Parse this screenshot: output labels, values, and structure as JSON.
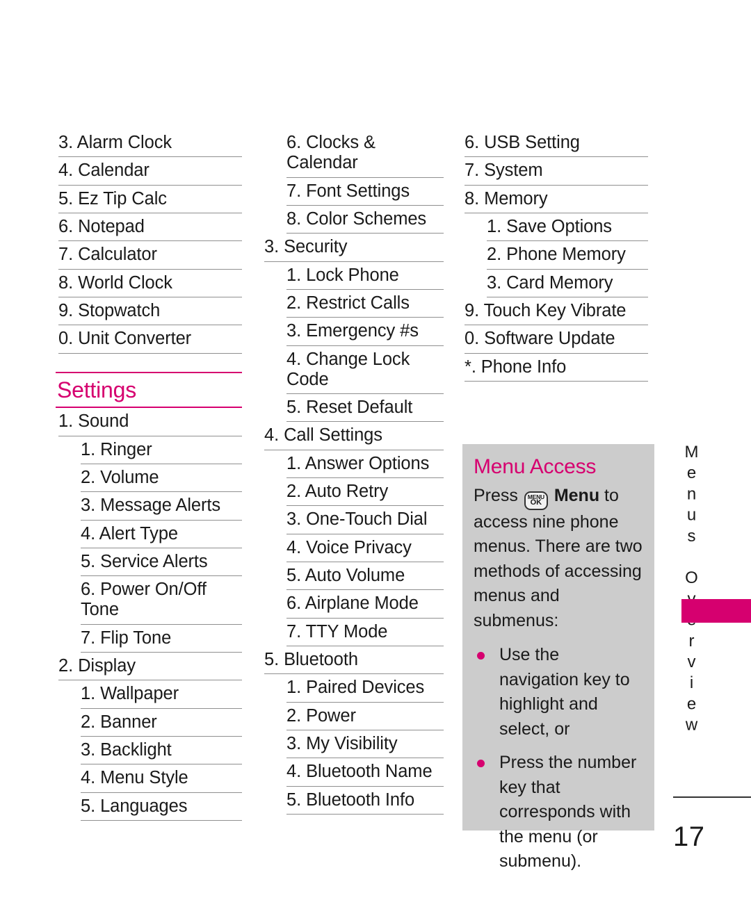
{
  "page": {
    "number": "17",
    "side_tab_label": "Menus Overview",
    "accent_color": "#d6006f",
    "rule_color": "#8f8f8f",
    "callout_bg": "#cccccc"
  },
  "columns": [
    {
      "id": "column-1",
      "items": [
        {
          "level": 2,
          "num": "3.",
          "label": "Alarm Clock"
        },
        {
          "level": 2,
          "num": "4.",
          "label": "Calendar"
        },
        {
          "level": 2,
          "num": "5.",
          "label": "Ez Tip Calc"
        },
        {
          "level": 2,
          "num": "6.",
          "label": "Notepad"
        },
        {
          "level": 2,
          "num": "7.",
          "label": "Calculator"
        },
        {
          "level": 2,
          "num": "8.",
          "label": "World Clock"
        },
        {
          "level": 2,
          "num": "9.",
          "label": "Stopwatch"
        },
        {
          "level": 2,
          "num": "0.",
          "label": "Unit Converter"
        }
      ],
      "section": {
        "title": "Settings",
        "items": [
          {
            "level": 2,
            "num": "1.",
            "label": "Sound"
          },
          {
            "level": 3,
            "num": "1.",
            "label": "Ringer"
          },
          {
            "level": 3,
            "num": "2.",
            "label": "Volume"
          },
          {
            "level": 3,
            "num": "3.",
            "label": "Message Alerts"
          },
          {
            "level": 3,
            "num": "4.",
            "label": "Alert Type"
          },
          {
            "level": 3,
            "num": "5.",
            "label": "Service Alerts"
          },
          {
            "level": 3,
            "num": "6.",
            "label": "Power On/Off Tone"
          },
          {
            "level": 3,
            "num": "7.",
            "label": "Flip Tone"
          },
          {
            "level": 2,
            "num": "2.",
            "label": "Display"
          },
          {
            "level": 3,
            "num": "1.",
            "label": "Wallpaper"
          },
          {
            "level": 3,
            "num": "2.",
            "label": "Banner"
          },
          {
            "level": 3,
            "num": "3.",
            "label": "Backlight"
          },
          {
            "level": 3,
            "num": "4.",
            "label": "Menu Style"
          },
          {
            "level": 3,
            "num": "5.",
            "label": "Languages"
          }
        ]
      }
    },
    {
      "id": "column-2",
      "items": [
        {
          "level": 3,
          "num": "6.",
          "label": "Clocks & Calendar"
        },
        {
          "level": 3,
          "num": "7.",
          "label": "Font Settings"
        },
        {
          "level": 3,
          "num": "8.",
          "label": "Color Schemes"
        },
        {
          "level": 2,
          "num": "3.",
          "label": "Security"
        },
        {
          "level": 3,
          "num": "1.",
          "label": "Lock Phone"
        },
        {
          "level": 3,
          "num": "2.",
          "label": "Restrict Calls"
        },
        {
          "level": 3,
          "num": "3.",
          "label": "Emergency #s"
        },
        {
          "level": 3,
          "num": "4.",
          "label": "Change Lock Code"
        },
        {
          "level": 3,
          "num": "5.",
          "label": "Reset Default"
        },
        {
          "level": 2,
          "num": "4.",
          "label": "Call Settings"
        },
        {
          "level": 3,
          "num": "1.",
          "label": "Answer Options"
        },
        {
          "level": 3,
          "num": "2.",
          "label": "Auto Retry"
        },
        {
          "level": 3,
          "num": "3.",
          "label": "One-Touch Dial"
        },
        {
          "level": 3,
          "num": "4.",
          "label": "Voice Privacy"
        },
        {
          "level": 3,
          "num": "5.",
          "label": "Auto Volume"
        },
        {
          "level": 3,
          "num": "6.",
          "label": "Airplane Mode"
        },
        {
          "level": 3,
          "num": "7.",
          "label": "TTY Mode"
        },
        {
          "level": 2,
          "num": "5.",
          "label": "Bluetooth"
        },
        {
          "level": 3,
          "num": "1.",
          "label": "Paired Devices"
        },
        {
          "level": 3,
          "num": "2.",
          "label": "Power"
        },
        {
          "level": 3,
          "num": "3.",
          "label": "My Visibility"
        },
        {
          "level": 3,
          "num": "4.",
          "label": "Bluetooth Name"
        },
        {
          "level": 3,
          "num": "5.",
          "label": "Bluetooth Info"
        }
      ]
    },
    {
      "id": "column-3",
      "items": [
        {
          "level": 2,
          "num": "6.",
          "label": "USB Setting"
        },
        {
          "level": 2,
          "num": "7.",
          "label": "System"
        },
        {
          "level": 2,
          "num": "8.",
          "label": "Memory"
        },
        {
          "level": 3,
          "num": "1.",
          "label": "Save Options"
        },
        {
          "level": 3,
          "num": "2.",
          "label": "Phone Memory"
        },
        {
          "level": 3,
          "num": "3.",
          "label": "Card Memory"
        },
        {
          "level": 2,
          "num": "9.",
          "label": "Touch Key Vibrate"
        },
        {
          "level": 2,
          "num": "0.",
          "label": "Software Update"
        },
        {
          "level": 2,
          "num": "*.",
          "label": "Phone Info"
        }
      ]
    }
  ],
  "callout": {
    "title": "Menu Access",
    "intro_before_key": "Press",
    "key_line1": "MENU",
    "key_line2": "OK",
    "intro_bold": "Menu",
    "intro_after_key": "to access nine phone menus. There are two methods of accessing menus and submenus:",
    "bullets": [
      "Use the navigation key to highlight and select, or",
      "Press the number key that corresponds with the menu (or submenu)."
    ]
  }
}
